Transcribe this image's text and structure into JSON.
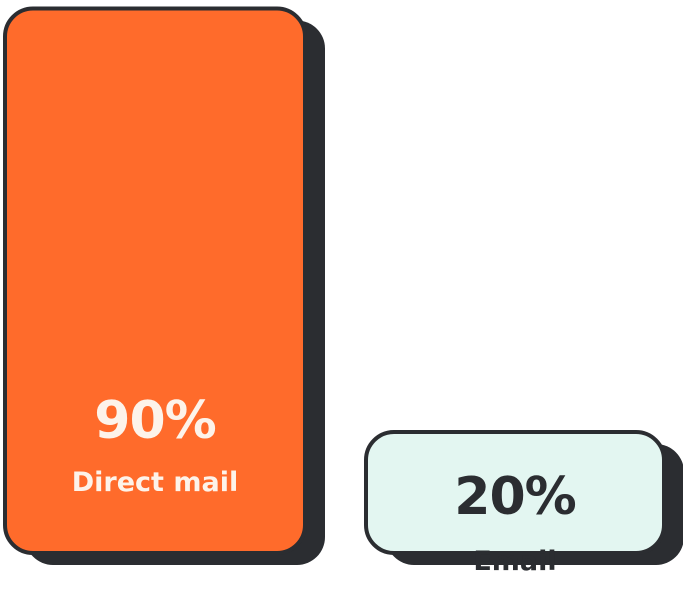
{
  "chart_data": {
    "type": "bar",
    "categories": [
      "Direct mail",
      "Email"
    ],
    "values": [
      90,
      20
    ],
    "value_labels": [
      "90%",
      "20%"
    ],
    "ylim": [
      0,
      100
    ],
    "grid": false,
    "legend": "none",
    "title": "",
    "xlabel": "",
    "ylabel": ""
  },
  "colors": {
    "direct_mail_fill": "#ff6b2b",
    "email_fill": "#e3f6f1",
    "outline": "#2b2d31",
    "shadow": "#2b2d31",
    "direct_mail_text": "#fdf3ea",
    "email_text": "#2b2d31"
  }
}
